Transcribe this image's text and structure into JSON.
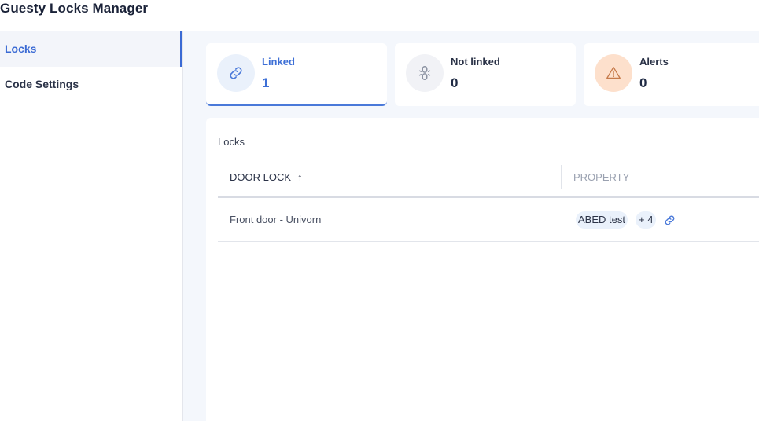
{
  "app": {
    "title": "Guesty Locks Manager"
  },
  "sidebar": {
    "items": [
      {
        "label": "Locks",
        "active": true
      },
      {
        "label": "Code Settings",
        "active": false
      }
    ]
  },
  "stats": [
    {
      "label": "Linked",
      "value": "1",
      "icon": "link-icon",
      "selected": true
    },
    {
      "label": "Not linked",
      "value": "0",
      "icon": "broken-link-icon",
      "selected": false
    },
    {
      "label": "Alerts",
      "value": "0",
      "icon": "warning-icon",
      "selected": false
    }
  ],
  "colors": {
    "accent": "#3d6fd6",
    "linked_icon_bg": "#eaf1fb",
    "not_linked_icon_bg": "#f1f2f6",
    "alerts_icon_bg": "#fde0cc",
    "alerts_icon": "#e08a55",
    "page_bg": "#f4f7fc"
  },
  "locks_panel": {
    "title": "Locks",
    "columns": [
      {
        "label": "DOOR LOCK",
        "sort": "↑"
      },
      {
        "label": "PROPERTY"
      }
    ],
    "rows": [
      {
        "door_lock": "Front door - Univorn",
        "property": "ABED test",
        "more": "+ 4",
        "icon": "link-icon"
      }
    ]
  }
}
